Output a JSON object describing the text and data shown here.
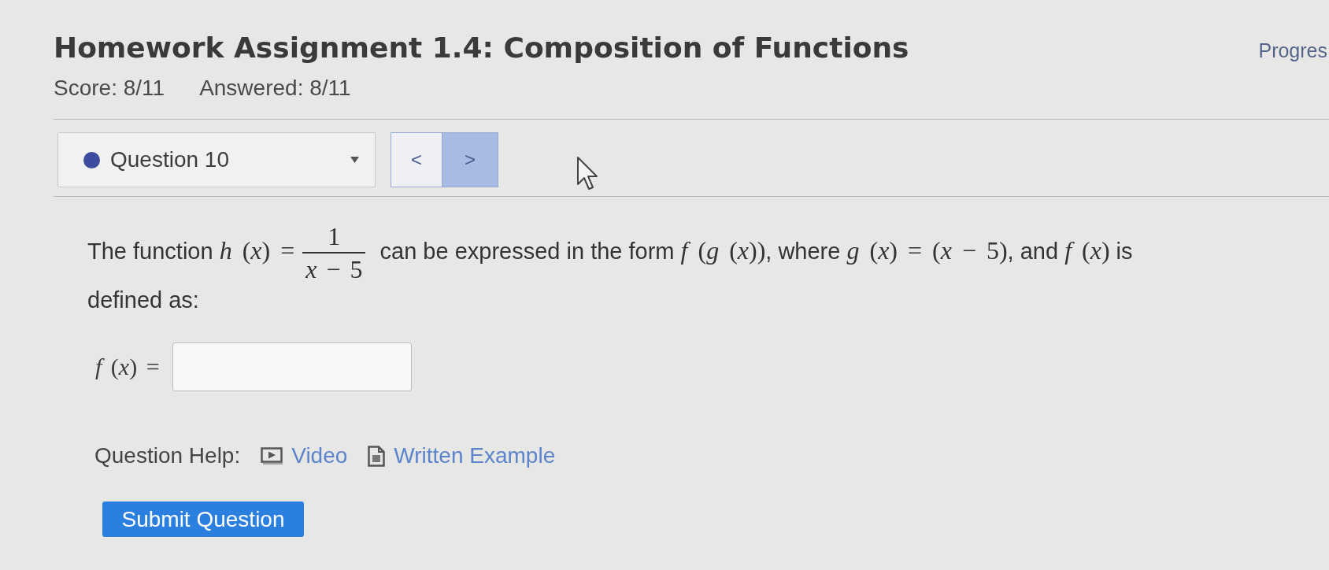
{
  "header": {
    "title": "Homework Assignment 1.4: Composition of Functions",
    "side_label": "Progres"
  },
  "score": {
    "score": "Score: 8/11",
    "answered": "Answered: 8/11"
  },
  "question_nav": {
    "selector": {
      "label": "Question 10"
    },
    "buttons": [
      {
        "label": "<",
        "highlighted": false
      },
      {
        "label": ">",
        "highlighted": true
      }
    ]
  },
  "question": {
    "prompt": [
      {
        "kind": "text",
        "text": "The function "
      },
      {
        "kind": "math",
        "text": "*h* (*x*) ="
      },
      {
        "kind": "fraction",
        "numerator": "1",
        "denominator": "*x* − 5"
      },
      {
        "kind": "text",
        "text": " can be expressed in the form "
      },
      {
        "kind": "math",
        "text": "*f* (*g* (*x*))"
      },
      {
        "kind": "text",
        "text": ", where "
      },
      {
        "kind": "math",
        "text": "*g* (*x*) = (*x* − 5)"
      },
      {
        "kind": "text",
        "text": ", and "
      },
      {
        "kind": "math",
        "text": "*f* (*x*)"
      },
      {
        "kind": "text",
        "text": " is defined as:"
      }
    ],
    "answer": {
      "label": "*f* (*x*) ="
    }
  },
  "help": {
    "label": "Question Help:",
    "links": [
      {
        "kind": "video",
        "label": "Video"
      },
      {
        "kind": "document",
        "label": "Written Example"
      }
    ]
  },
  "submit": {
    "label": "Submit Question"
  }
}
